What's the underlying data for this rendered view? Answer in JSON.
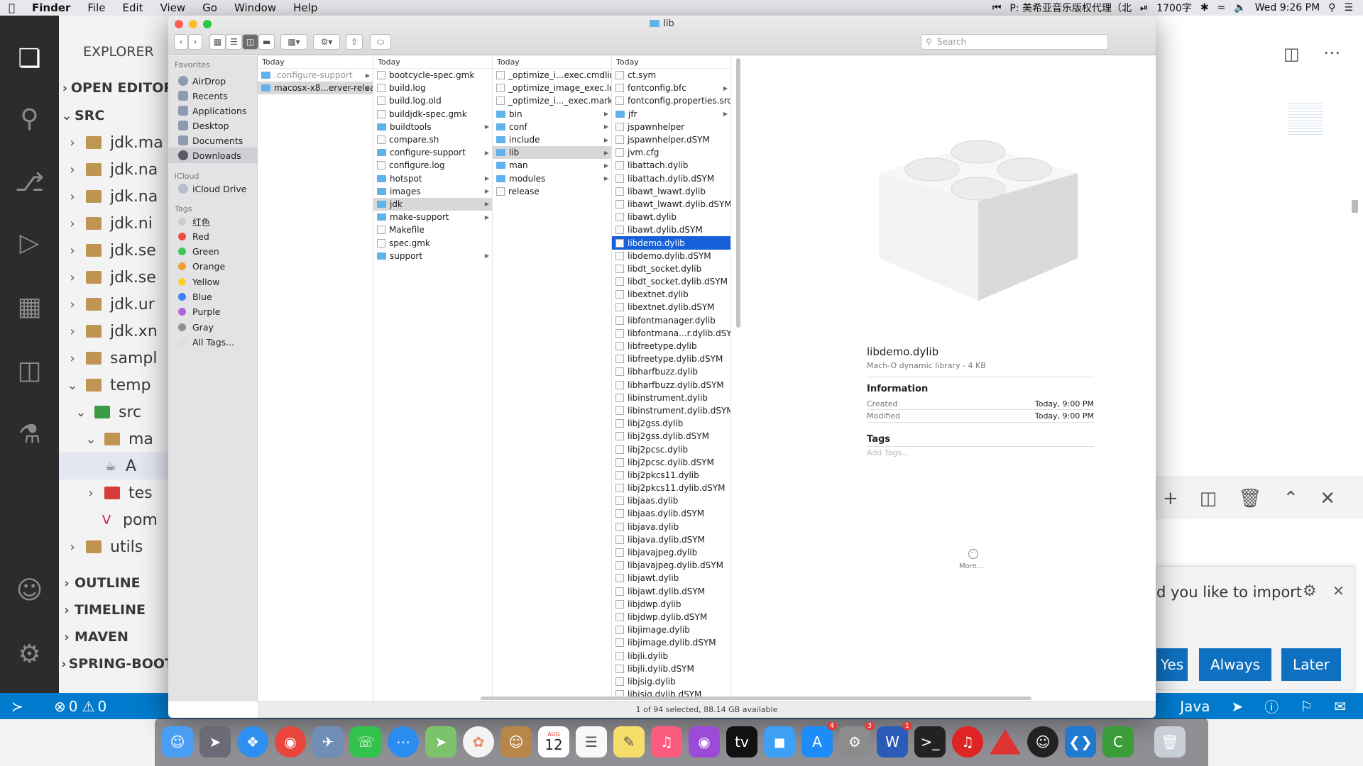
{
  "menubar": {
    "app": "Finder",
    "items": [
      "File",
      "Edit",
      "View",
      "Go",
      "Window",
      "Help"
    ],
    "music_text": "P: 美希亚音乐版权代理（北",
    "char_count": "1700字",
    "clock": "Wed 9:26 PM"
  },
  "vscode": {
    "explorer_title": "EXPLORER",
    "sections": {
      "open_editors": "OPEN EDITOR",
      "src": "SRC",
      "outline": "OUTLINE",
      "timeline": "TIMELINE",
      "maven": "MAVEN",
      "spring": "SPRING-BOOT"
    },
    "tree": [
      "jdk.ma",
      "jdk.na",
      "jdk.na",
      "jdk.ni",
      "jdk.se",
      "jdk.se",
      "jdk.ur",
      "jdk.xn",
      "sampl",
      "temp",
      "src",
      "ma",
      "A",
      "tes",
      "pom",
      "utils"
    ],
    "notification": {
      "message": "d you like to import",
      "yes": "Yes",
      "always": "Always",
      "later": "Later"
    },
    "status": {
      "errors": "0",
      "warnings": "0",
      "language": "Java"
    }
  },
  "finder": {
    "title": "lib",
    "search_placeholder": "Search",
    "sidebar": {
      "favorites_header": "Favorites",
      "favorites": [
        "AirDrop",
        "Recents",
        "Applications",
        "Desktop",
        "Documents",
        "Downloads"
      ],
      "icloud_header": "iCloud",
      "icloud": [
        "iCloud Drive"
      ],
      "tags_header": "Tags",
      "tags": [
        {
          "name": "红色",
          "color": "#cccccc"
        },
        {
          "name": "Red",
          "color": "#f04a45"
        },
        {
          "name": "Green",
          "color": "#43c355"
        },
        {
          "name": "Orange",
          "color": "#f59a34"
        },
        {
          "name": "Yellow",
          "color": "#f7cf33"
        },
        {
          "name": "Blue",
          "color": "#3a82f6"
        },
        {
          "name": "Purple",
          "color": "#b064d8"
        },
        {
          "name": "Gray",
          "color": "#8e8e93"
        },
        {
          "name": "All Tags...",
          "color": "#dddddd"
        }
      ]
    },
    "col_header": "Today",
    "columns": [
      [
        {
          "name": ".configure-support",
          "dir": true,
          "dim": true
        },
        {
          "name": "macosx-x8...erver-release",
          "dir": true,
          "sel": "gray"
        }
      ],
      [
        {
          "name": "bootcycle-spec.gmk"
        },
        {
          "name": "build.log"
        },
        {
          "name": "build.log.old"
        },
        {
          "name": "buildjdk-spec.gmk"
        },
        {
          "name": "buildtools",
          "dir": true
        },
        {
          "name": "compare.sh"
        },
        {
          "name": "configure-support",
          "dir": true
        },
        {
          "name": "configure.log"
        },
        {
          "name": "hotspot",
          "dir": true
        },
        {
          "name": "images",
          "dir": true
        },
        {
          "name": "jdk",
          "dir": true,
          "sel": "gray"
        },
        {
          "name": "make-support",
          "dir": true
        },
        {
          "name": "Makefile"
        },
        {
          "name": "spec.gmk"
        },
        {
          "name": "support",
          "dir": true
        }
      ],
      [
        {
          "name": "_optimize_i...exec.cmdline"
        },
        {
          "name": "_optimize_image_exec.log"
        },
        {
          "name": "_optimize_i..._exec.marker"
        },
        {
          "name": "bin",
          "dir": true
        },
        {
          "name": "conf",
          "dir": true
        },
        {
          "name": "include",
          "dir": true
        },
        {
          "name": "lib",
          "dir": true,
          "sel": "gray"
        },
        {
          "name": "man",
          "dir": true
        },
        {
          "name": "modules",
          "dir": true
        },
        {
          "name": "release"
        }
      ],
      [
        {
          "name": "ct.sym"
        },
        {
          "name": "fontconfig.bfc",
          "arrow": true
        },
        {
          "name": "fontconfig.properties.src"
        },
        {
          "name": "jfr",
          "dir": true
        },
        {
          "name": "jspawnhelper"
        },
        {
          "name": "jspawnhelper.dSYM"
        },
        {
          "name": "jvm.cfg"
        },
        {
          "name": "libattach.dylib"
        },
        {
          "name": "libattach.dylib.dSYM"
        },
        {
          "name": "libawt_lwawt.dylib"
        },
        {
          "name": "libawt_lwawt.dylib.dSYM"
        },
        {
          "name": "libawt.dylib"
        },
        {
          "name": "libawt.dylib.dSYM"
        },
        {
          "name": "libdemo.dylib",
          "sel": "blue"
        },
        {
          "name": "libdemo.dylib.dSYM"
        },
        {
          "name": "libdt_socket.dylib"
        },
        {
          "name": "libdt_socket.dylib.dSYM"
        },
        {
          "name": "libextnet.dylib"
        },
        {
          "name": "libextnet.dylib.dSYM"
        },
        {
          "name": "libfontmanager.dylib"
        },
        {
          "name": "libfontmana...r.dylib.dSYM"
        },
        {
          "name": "libfreetype.dylib"
        },
        {
          "name": "libfreetype.dylib.dSYM"
        },
        {
          "name": "libharfbuzz.dylib"
        },
        {
          "name": "libharfbuzz.dylib.dSYM"
        },
        {
          "name": "libinstrument.dylib"
        },
        {
          "name": "libinstrument.dylib.dSYM"
        },
        {
          "name": "libj2gss.dylib"
        },
        {
          "name": "libj2gss.dylib.dSYM"
        },
        {
          "name": "libj2pcsc.dylib"
        },
        {
          "name": "libj2pcsc.dylib.dSYM"
        },
        {
          "name": "libj2pkcs11.dylib"
        },
        {
          "name": "libj2pkcs11.dylib.dSYM"
        },
        {
          "name": "libjaas.dylib"
        },
        {
          "name": "libjaas.dylib.dSYM"
        },
        {
          "name": "libjava.dylib"
        },
        {
          "name": "libjava.dylib.dSYM"
        },
        {
          "name": "libjavajpeg.dylib"
        },
        {
          "name": "libjavajpeg.dylib.dSYM"
        },
        {
          "name": "libjawt.dylib"
        },
        {
          "name": "libjawt.dylib.dSYM"
        },
        {
          "name": "libjdwp.dylib"
        },
        {
          "name": "libjdwp.dylib.dSYM"
        },
        {
          "name": "libjimage.dylib"
        },
        {
          "name": "libjimage.dylib.dSYM"
        },
        {
          "name": "libjli.dylib"
        },
        {
          "name": "libjli.dylib.dSYM"
        },
        {
          "name": "libjsig.dylib"
        },
        {
          "name": "libjsig.dylib.dSYM"
        }
      ]
    ],
    "preview": {
      "name": "libdemo.dylib",
      "kind": "Mach-O dynamic library - 4 KB",
      "info_header": "Information",
      "created_label": "Created",
      "created": "Today, 9:00 PM",
      "modified_label": "Modified",
      "modified": "Today, 9:00 PM",
      "tags_header": "Tags",
      "add_tags": "Add Tags...",
      "more": "More..."
    },
    "status": "1 of 94 selected, 88.14 GB available"
  },
  "dock": {
    "calendar_month": "AUG",
    "calendar_day": "12",
    "badges": {
      "appstore": "4",
      "prefs": "3",
      "word": "1"
    }
  }
}
